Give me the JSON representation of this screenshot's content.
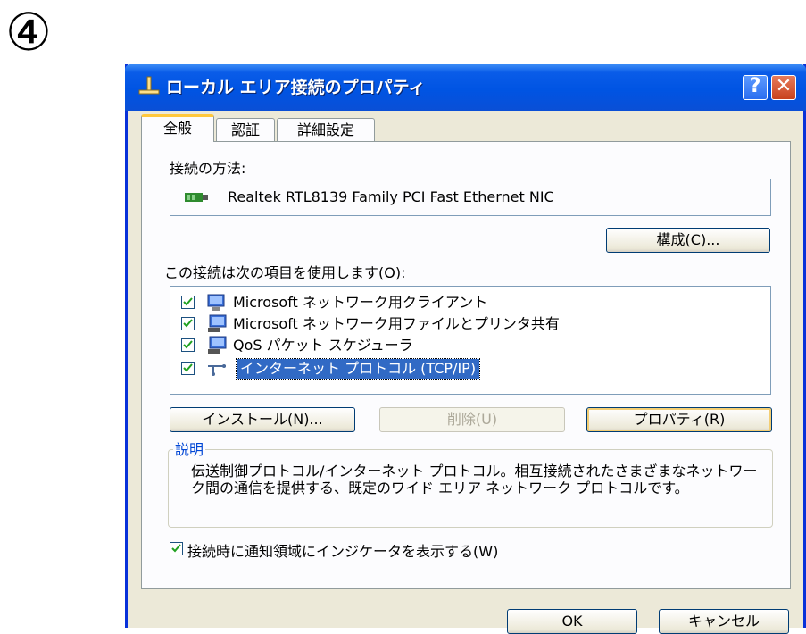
{
  "step_marker": "④",
  "window": {
    "title": "ローカル エリア接続のプロパティ",
    "help_label": "?",
    "close_label": "✕"
  },
  "tabs": [
    {
      "label": "全般",
      "active": true
    },
    {
      "label": "認証",
      "active": false
    },
    {
      "label": "詳細設定",
      "active": false
    }
  ],
  "general": {
    "connect_using_label": "接続の方法:",
    "adapter_name": "Realtek RTL8139 Family PCI Fast Ethernet NIC",
    "configure_button": "構成(C)...",
    "items_label": "この接続は次の項目を使用します(O):",
    "items": [
      {
        "label": "Microsoft ネットワーク用クライアント",
        "checked": true,
        "icon": "network-client-icon"
      },
      {
        "label": "Microsoft ネットワーク用ファイルとプリンタ共有",
        "checked": true,
        "icon": "network-service-icon"
      },
      {
        "label": "QoS パケット スケジューラ",
        "checked": true,
        "icon": "network-service-icon"
      },
      {
        "label": "インターネット プロトコル (TCP/IP)",
        "checked": true,
        "icon": "protocol-icon",
        "selected": true
      }
    ],
    "install_button": "インストール(N)...",
    "uninstall_button": "削除(U)",
    "properties_button": "プロパティ(R)",
    "description_title": "説明",
    "description_text": "伝送制御プロトコル/インターネット プロトコル。相互接続されたさまざまなネットワーク間の通信を提供する、既定のワイド エリア ネットワーク プロトコルです。",
    "notify_label": "接続時に通知領域にインジケータを表示する(W)",
    "notify_checked": true
  },
  "footer": {
    "ok_button": "OK",
    "cancel_button": "キャンセル"
  },
  "colors": {
    "titlebar": "#0054e3",
    "selection": "#316ac5",
    "group_title": "#0046d5"
  }
}
